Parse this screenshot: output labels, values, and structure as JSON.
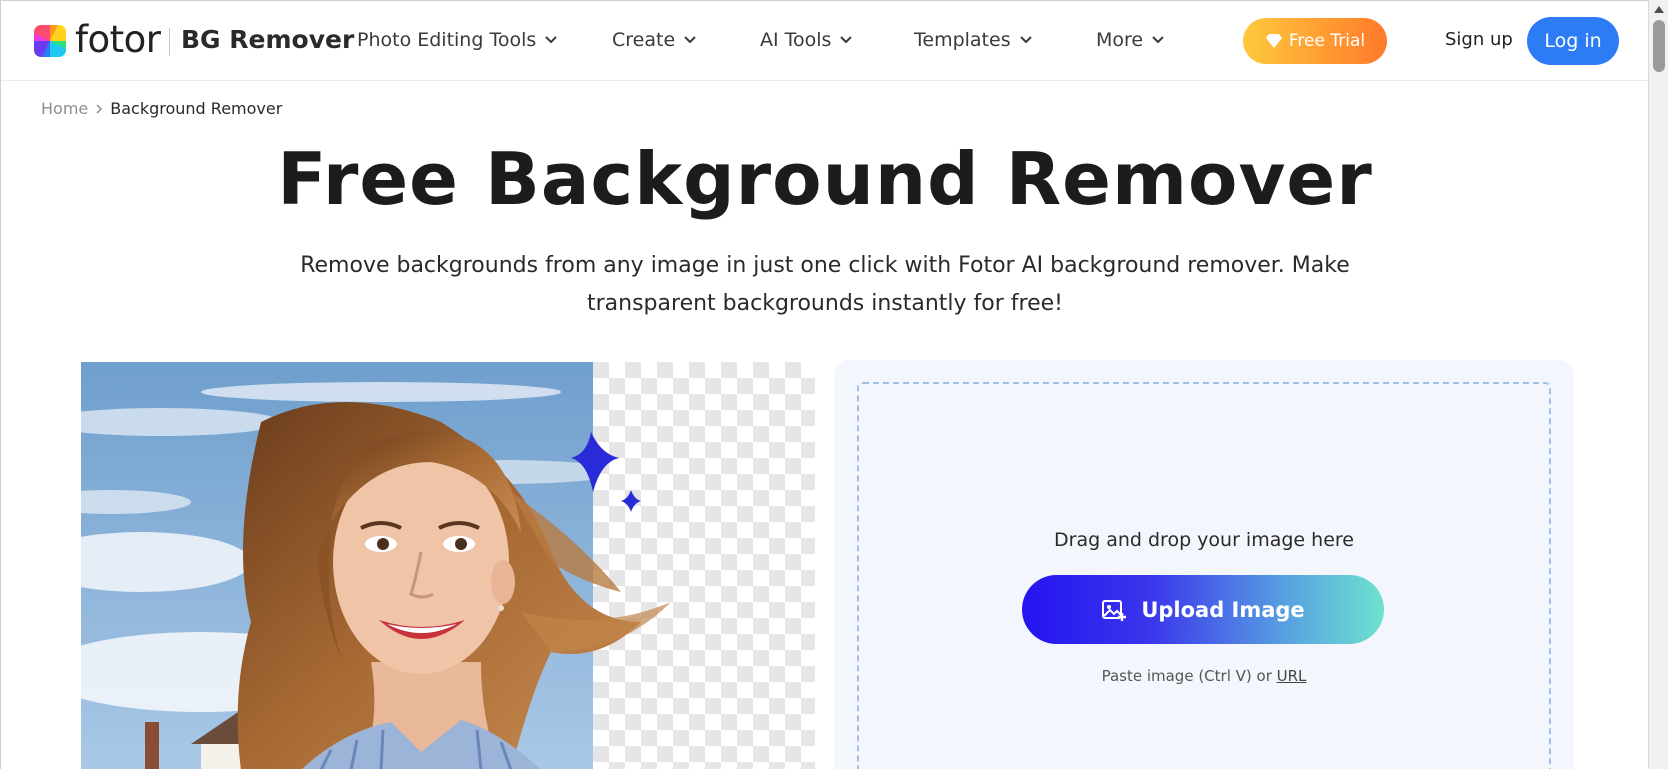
{
  "header": {
    "brand": "fotor",
    "product": "BG Remover",
    "nav": [
      {
        "label": "Photo Editing Tools"
      },
      {
        "label": "Create"
      },
      {
        "label": "AI Tools"
      },
      {
        "label": "Templates"
      },
      {
        "label": "More"
      }
    ],
    "free_trial_label": "Free Trial",
    "signup_label": "Sign up",
    "login_label": "Log in"
  },
  "breadcrumb": {
    "home": "Home",
    "current": "Background Remover"
  },
  "hero": {
    "title": "Free Background Remover",
    "subtitle_line1": "Remove backgrounds from any image in just one click with Fotor AI background remover. Make",
    "subtitle_line2": "transparent backgrounds instantly for free!"
  },
  "upload": {
    "drag_text": "Drag and drop your image here",
    "button_label": "Upload Image",
    "paste_text": "Paste image (Ctrl V) or ",
    "url_label": "URL"
  },
  "colors": {
    "login": "#2d7cf6",
    "trial_start": "#ffc93d",
    "trial_end": "#ff7a2a",
    "upload_start": "#2414f0",
    "upload_end": "#6ee2cf"
  }
}
